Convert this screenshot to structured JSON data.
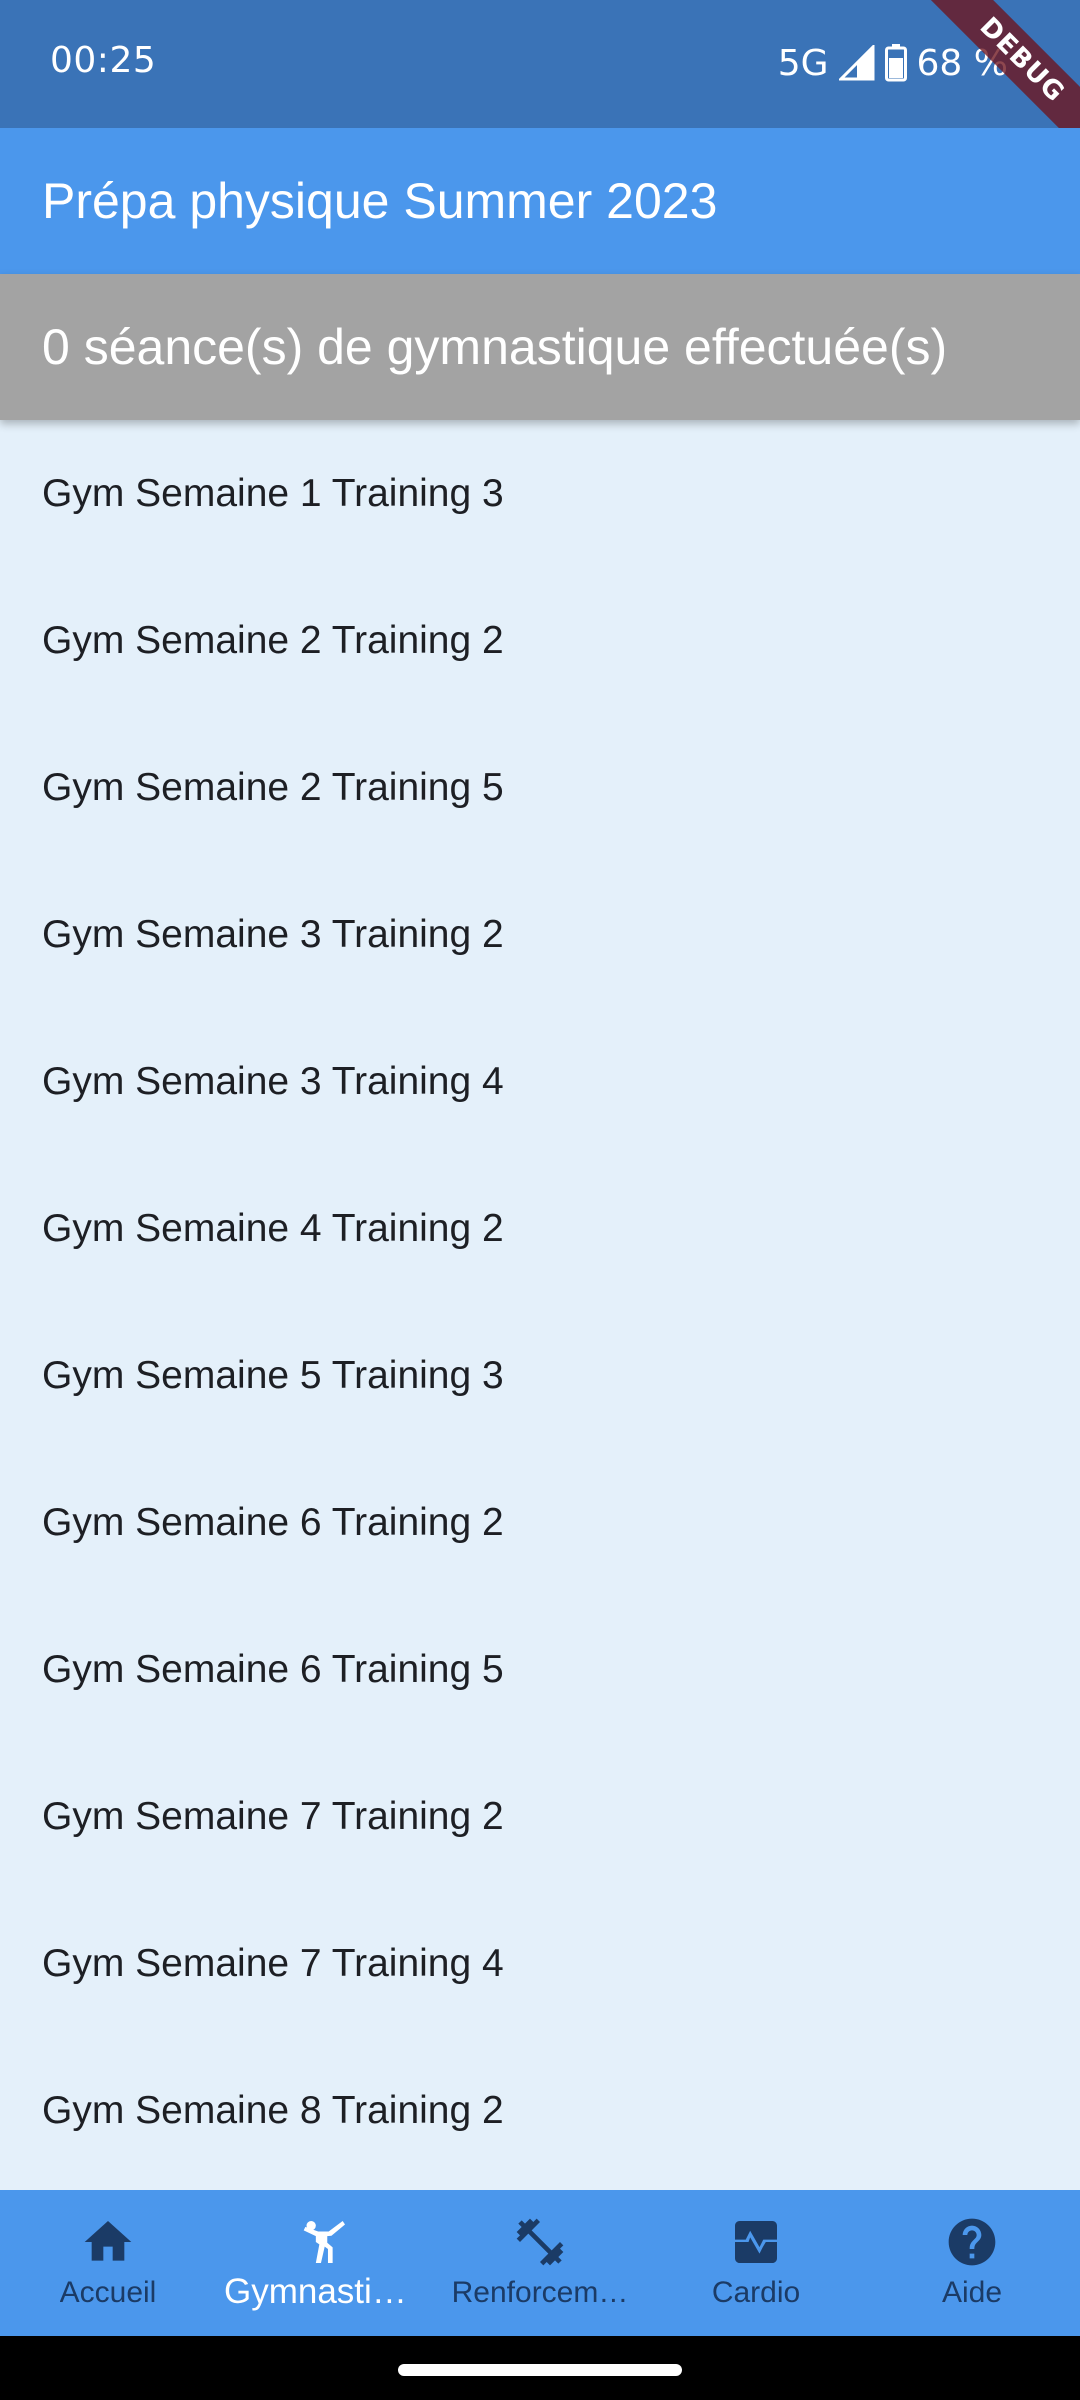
{
  "status_bar": {
    "time": "00:25",
    "network": "5G",
    "battery": "68 %"
  },
  "debug_banner": "DEBUG",
  "app_bar": {
    "title": "Prépa physique Summer 2023"
  },
  "counter": {
    "text": "0 séance(s) de gymnastique effectuée(s)"
  },
  "sessions": [
    "Gym Semaine 1 Training 3",
    "Gym Semaine 2 Training 2",
    "Gym Semaine 2 Training 5",
    "Gym Semaine 3 Training 2",
    "Gym Semaine 3 Training 4",
    "Gym Semaine 4 Training 2",
    "Gym Semaine 5 Training 3",
    "Gym Semaine 6 Training 2",
    "Gym Semaine 6 Training 5",
    "Gym Semaine 7 Training 2",
    "Gym Semaine 7 Training 4",
    "Gym Semaine 8 Training 2"
  ],
  "bottom_nav": {
    "items": [
      {
        "label": "Accueil",
        "icon": "home-icon",
        "active": false
      },
      {
        "label": "Gymnastiq…",
        "icon": "gymnastics-icon",
        "active": true
      },
      {
        "label": "Renforcem…",
        "icon": "dumbbell-icon",
        "active": false
      },
      {
        "label": "Cardio",
        "icon": "heartbeat-monitor-icon",
        "active": false
      },
      {
        "label": "Aide",
        "icon": "help-icon",
        "active": false
      }
    ]
  },
  "colors": {
    "status_bar": "#3A73B7",
    "app_bar": "#4B97EC",
    "counter_banner": "#A3A3A3",
    "list_background": "#E4F0FA",
    "nav_inactive": "#1B3B66",
    "nav_active": "#FFFFFF"
  }
}
